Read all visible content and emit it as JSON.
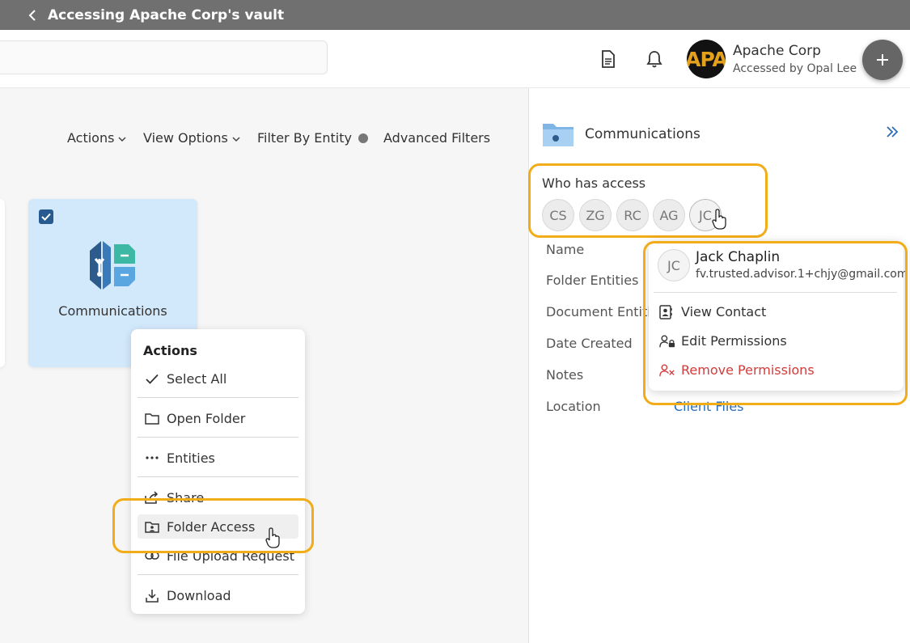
{
  "topbar": {
    "title": "Accessing Apache Corp's vault"
  },
  "header": {
    "logo_text": "APA",
    "org_name": "Apache Corp",
    "org_sub": "Accessed by Opal Lee",
    "icons": [
      "document-icon",
      "bell-icon",
      "plus-icon"
    ]
  },
  "toolbar": {
    "actions": "Actions",
    "view_options": "View Options",
    "filter_by_entity": "Filter By Entity",
    "advanced_filters": "Advanced Filters"
  },
  "folder_card": {
    "name": "Communications",
    "checked": true
  },
  "actions_menu": {
    "title": "Actions",
    "items": [
      {
        "label": "Select All",
        "icon": "check-icon"
      },
      {
        "label": "Open Folder",
        "icon": "folder-icon"
      },
      {
        "label": "Entities",
        "icon": "ellipsis-icon"
      },
      {
        "label": "Share",
        "icon": "share-icon"
      },
      {
        "label": "Folder Access",
        "icon": "folder-user-icon"
      },
      {
        "label": "File Upload Request",
        "icon": "link-icon"
      },
      {
        "label": "Download",
        "icon": "download-icon"
      }
    ]
  },
  "panel": {
    "title": "Communications",
    "who_has_access": "Who has access",
    "avatars": [
      "CS",
      "ZG",
      "RC",
      "AG",
      "JC"
    ],
    "fields": [
      {
        "label": "Name"
      },
      {
        "label": "Folder Entities"
      },
      {
        "label": "Document Entities"
      },
      {
        "label": "Date Created"
      },
      {
        "label": "Notes"
      },
      {
        "label": "Location",
        "value": "Client Files"
      }
    ]
  },
  "contact_popover": {
    "initials": "JC",
    "name": "Jack Chaplin",
    "email": "fv.trusted.advisor.1+chjy@gmail.com",
    "items": [
      {
        "label": "View Contact",
        "icon": "contact-card-icon"
      },
      {
        "label": "Edit Permissions",
        "icon": "user-lock-icon"
      },
      {
        "label": "Remove Permissions",
        "icon": "user-remove-icon"
      }
    ]
  },
  "colors": {
    "highlight": "#f1ac18",
    "link": "#2a6db5",
    "danger": "#d23c3c",
    "accent": "#275b8f"
  }
}
